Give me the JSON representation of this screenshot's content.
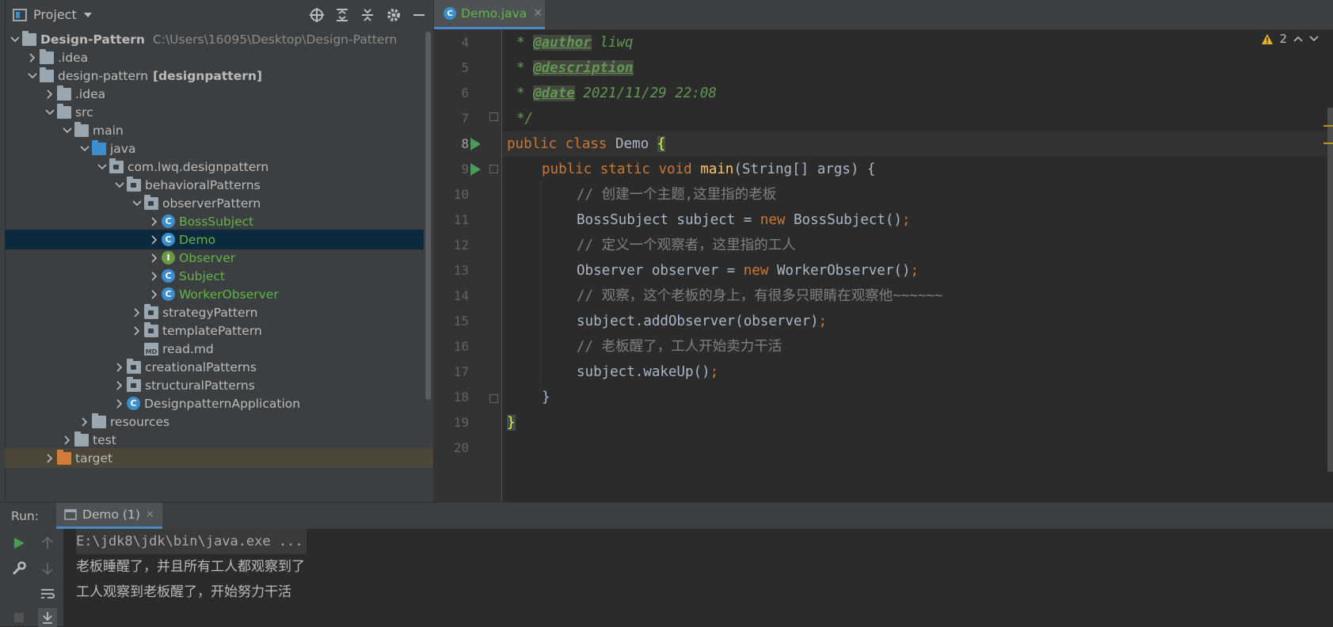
{
  "project_panel": {
    "title": "Project",
    "tree": [
      {
        "label": "Design-Pattern",
        "path": "C:\\Users\\16095\\Desktop\\Design-Pattern"
      },
      {
        "label": ".idea"
      },
      {
        "label": "design-pattern",
        "module": "[designpattern]"
      },
      {
        "label": ".idea"
      },
      {
        "label": "src"
      },
      {
        "label": "main"
      },
      {
        "label": "java"
      },
      {
        "label": "com.lwq.designpattern"
      },
      {
        "label": "behavioralPatterns"
      },
      {
        "label": "observerPattern"
      },
      {
        "label": "BossSubject",
        "icon_letter": "C"
      },
      {
        "label": "Demo",
        "icon_letter": "C"
      },
      {
        "label": "Observer",
        "icon_letter": "I"
      },
      {
        "label": "Subject",
        "icon_letter": "C"
      },
      {
        "label": "WorkerObserver",
        "icon_letter": "C"
      },
      {
        "label": "strategyPattern"
      },
      {
        "label": "templatePattern"
      },
      {
        "label": "read.md",
        "icon_letter": "MD"
      },
      {
        "label": "creationalPatterns"
      },
      {
        "label": "structuralPatterns"
      },
      {
        "label": "DesignpatternApplication",
        "icon_letter": "C"
      },
      {
        "label": "resources"
      },
      {
        "label": "test"
      },
      {
        "label": "target"
      }
    ]
  },
  "editor": {
    "tab_label": "Demo.java",
    "tab_icon_letter": "C",
    "warning_count": "2",
    "line_numbers": [
      "4",
      "5",
      "6",
      "7",
      "8",
      "9",
      "10",
      "11",
      "12",
      "13",
      "14",
      "15",
      "16",
      "17",
      "18",
      "19",
      "20"
    ],
    "lines": {
      "l4_star": "* ",
      "l4_tag": "@author",
      "l4_text": " liwq",
      "l5_star": "* ",
      "l5_tag": "@description",
      "l6_star": "* ",
      "l6_tag": "@date",
      "l6_text": " 2021/11/29 22:08",
      "l7": "*/",
      "l8_kw": "public class ",
      "l8_name": "Demo ",
      "l8_brace": "{",
      "l9_kw": "public static void ",
      "l9_fn": "main",
      "l9_rest": "(String[] args) {",
      "l10": "// 创建一个主题,这里指的老板",
      "l11_a": "BossSubject subject = ",
      "l11_kw": "new ",
      "l11_b": "BossSubject()",
      "l11_semi": ";",
      "l12": "// 定义一个观察者，这里指的工人",
      "l13_a": "Observer observer = ",
      "l13_kw": "new ",
      "l13_b": "WorkerObserver()",
      "l13_semi": ";",
      "l14": "// 观察，这个老板的身上，有很多只眼睛在观察他~~~~~~",
      "l15_a": "subject.addObserver(observer)",
      "l15_semi": ";",
      "l16": "// 老板醒了，工人开始卖力干活",
      "l17_a": "subject.wakeUp()",
      "l17_semi": ";",
      "l18": "}",
      "l19": "}"
    }
  },
  "run_panel": {
    "label": "Run:",
    "tab_label": "Demo (1)",
    "output": [
      "E:\\jdk8\\jdk\\bin\\java.exe ...",
      "老板睡醒了，并且所有工人都观察到了",
      "工人观察到老板醒了，开始努力干活"
    ]
  },
  "colors": {
    "background": "#2b2b2b",
    "panel": "#3c3f41",
    "selection": "#0d293e",
    "keyword": "#cc7832",
    "doc_comment": "#629755",
    "green_file": "#62b543",
    "accent": "#4a88c7"
  }
}
